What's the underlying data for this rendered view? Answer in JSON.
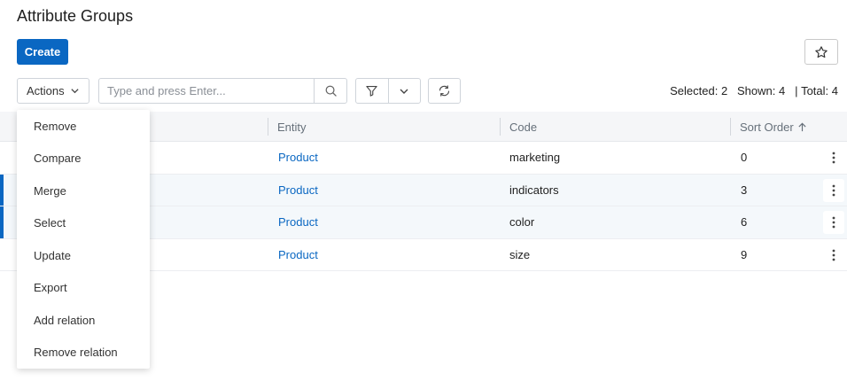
{
  "page": {
    "title": "Attribute Groups"
  },
  "toolbar": {
    "create_label": "Create",
    "actions_label": "Actions",
    "search_placeholder": "Type and press Enter..."
  },
  "counts": {
    "selected_label": "Selected: 2",
    "shown_label": "Shown: 4",
    "separator": "|",
    "total_label": "Total: 4"
  },
  "table": {
    "headers": {
      "entity": "Entity",
      "code": "Code",
      "sort_order": "Sort Order"
    },
    "rows": [
      {
        "entity": "Product",
        "code": "marketing",
        "sort_order": "0",
        "selected": false
      },
      {
        "entity": "Product",
        "code": "indicators",
        "sort_order": "3",
        "selected": true
      },
      {
        "entity": "Product",
        "code": "color",
        "sort_order": "6",
        "selected": true
      },
      {
        "entity": "Product",
        "code": "size",
        "sort_order": "9",
        "selected": false
      }
    ]
  },
  "actions_menu": {
    "items": [
      "Remove",
      "Compare",
      "Merge",
      "Select",
      "Update",
      "Export",
      "Add relation",
      "Remove relation"
    ]
  },
  "colors": {
    "accent": "#0a67c2",
    "header_bg": "#f5f6f8",
    "selected_row_bg": "#f4f8fb"
  },
  "icons": {
    "star": "star-icon",
    "chevron": "chevron-down-icon",
    "search": "search-icon",
    "filter": "filter-icon",
    "refresh": "refresh-icon",
    "kebab": "kebab-icon",
    "sort": "arrow-up-icon"
  }
}
